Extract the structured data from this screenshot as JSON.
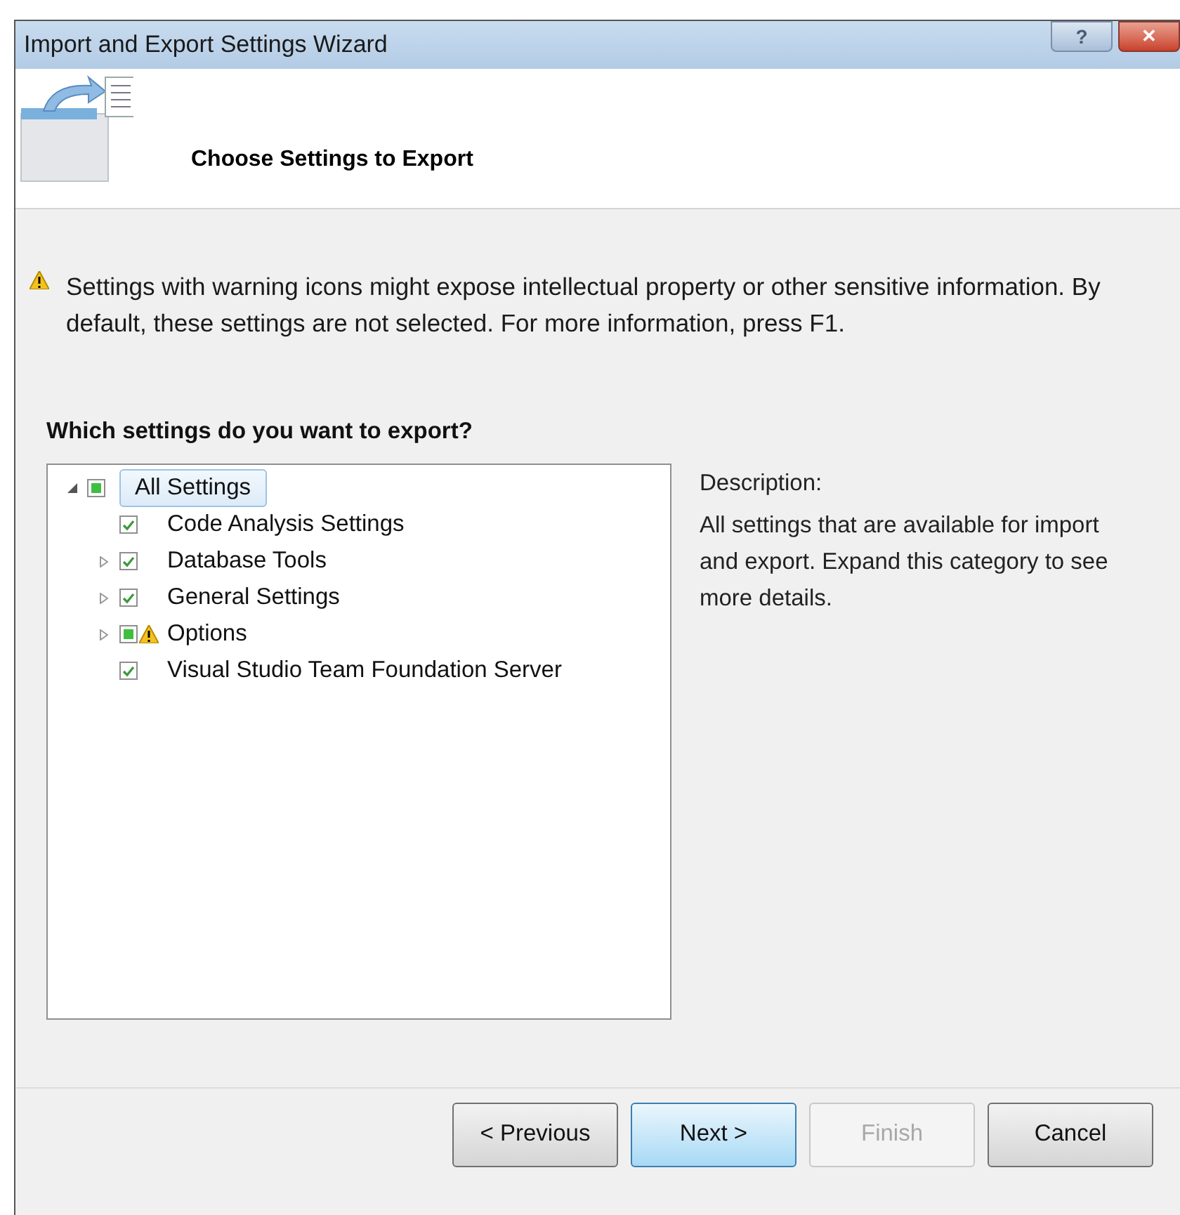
{
  "window": {
    "title": "Import and Export Settings Wizard",
    "buttons": [
      {
        "kind": "help",
        "label": "?"
      },
      {
        "kind": "close",
        "label": "✕"
      }
    ]
  },
  "header": {
    "title": "Choose Settings to Export"
  },
  "warning": {
    "text": "Settings with warning icons might expose intellectual property or other sensitive information. By default, these settings are not selected. For more information, press F1."
  },
  "question": "Which settings do you want to export?",
  "tree": [
    {
      "label": "All Settings",
      "checked": false,
      "indeterminate": true,
      "warning": false,
      "selected": true,
      "expanded": true,
      "children": [
        {
          "label": "Code Analysis Settings",
          "checked": true,
          "warning": false,
          "selected": false
        },
        {
          "label": "Database Tools",
          "checked": true,
          "warning": false,
          "selected": false,
          "expanded": false
        },
        {
          "label": "General Settings",
          "checked": true,
          "warning": false,
          "selected": false,
          "expanded": false
        },
        {
          "label": "Options",
          "checked": false,
          "indeterminate": true,
          "warning": true,
          "selected": false,
          "expanded": false
        },
        {
          "label": "Visual Studio Team Foundation Server",
          "checked": true,
          "warning": false,
          "selected": false
        }
      ]
    }
  ],
  "description": {
    "heading": "Description:",
    "text": "All settings that are available for import and export. Expand this category to see more details."
  },
  "buttons": [
    {
      "label": "< Previous",
      "disabled": false,
      "default": false
    },
    {
      "label": "Next >",
      "disabled": false,
      "default": true
    },
    {
      "label": "Finish",
      "disabled": true,
      "default": false
    },
    {
      "label": "Cancel",
      "disabled": false,
      "default": false
    }
  ]
}
